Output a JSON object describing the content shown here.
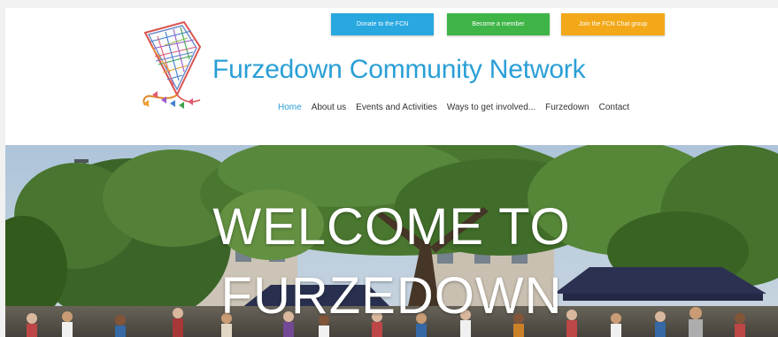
{
  "header": {
    "buttons": {
      "donate": "Donate to the FCN",
      "member": "Become a member",
      "chat": "Join the FCN Chat group"
    },
    "site_title": "Furzedown Community Network",
    "nav": [
      "Home",
      "About us",
      "Events and Activities",
      "Ways to get involved...",
      "Furzedown",
      "Contact"
    ],
    "active_nav": "Home"
  },
  "hero": {
    "line1": "WELCOME TO",
    "line2": "FURZEDOWN"
  },
  "colors": {
    "brand_blue": "#2a9fd6",
    "donate": "#29a8e0",
    "member": "#3fb548",
    "chat": "#f2a818",
    "nav_text": "#333333",
    "hero_text": "#ffffff"
  },
  "icons": {
    "logo": "kite-map-logo"
  }
}
